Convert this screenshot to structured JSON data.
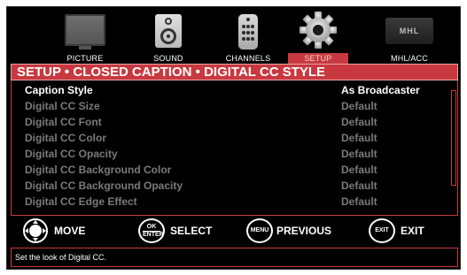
{
  "menu": {
    "items": [
      {
        "label": "PICTURE",
        "icon": "tv-icon"
      },
      {
        "label": "SOUND",
        "icon": "speaker-icon"
      },
      {
        "label": "CHANNELS",
        "icon": "remote-icon"
      },
      {
        "label": "SETUP",
        "icon": "gear-icon",
        "active": true
      },
      {
        "label": "MHL/ACC",
        "icon": "mhl-icon",
        "logo_text": "MHL"
      }
    ]
  },
  "header": {
    "title": "SETUP • CLOSED CAPTION • DIGITAL CC STYLE"
  },
  "settings": {
    "rows": [
      {
        "name": "Caption Style",
        "value": "As Broadcaster",
        "selected": true
      },
      {
        "name": "Digital CC Size",
        "value": "Default"
      },
      {
        "name": "Digital CC Font",
        "value": "Default"
      },
      {
        "name": "Digital CC Color",
        "value": "Default"
      },
      {
        "name": "Digital CC Opacity",
        "value": "Default"
      },
      {
        "name": "Digital CC Background Color",
        "value": "Default"
      },
      {
        "name": "Digital CC Background Opacity",
        "value": "Default"
      },
      {
        "name": "Digital CC Edge Effect",
        "value": "Default"
      }
    ]
  },
  "nav": {
    "move_label": "MOVE",
    "ok_label": "OK",
    "enter_label": "ENTER",
    "select_label": "SELECT",
    "menu_key": "MENU",
    "previous_label": "PREVIOUS",
    "exit_key": "EXIT",
    "exit_label": "EXIT"
  },
  "help": {
    "text": "Set the look of Digital CC."
  },
  "colors": {
    "accent": "#c8393f",
    "background": "#000000",
    "text": "#ffffff",
    "dim_text": "#7a7a7a"
  }
}
